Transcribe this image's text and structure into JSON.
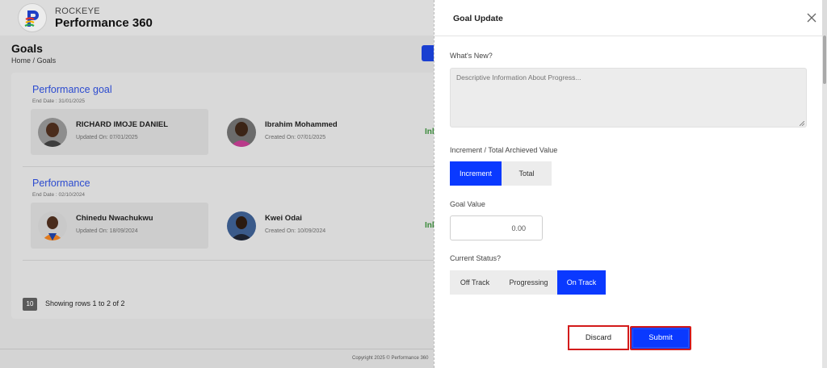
{
  "brand": {
    "small": "ROCKEYE",
    "big": "Performance 360"
  },
  "page": {
    "title": "Goals",
    "breadcrumb_home": "Home",
    "breadcrumb_sep": "/",
    "breadcrumb_current": "Goals"
  },
  "goals": [
    {
      "title": "Performance goal",
      "end_date": "End Date : 31/01/2025",
      "status_stub": "Inl",
      "people": [
        {
          "name": "RICHARD IMOJE DANIEL",
          "date": "Updated On: 07/01/2025"
        },
        {
          "name": "Ibrahim Mohammed",
          "date": "Created On: 07/01/2025"
        }
      ]
    },
    {
      "title": "Performance",
      "end_date": "End Date : 02/10/2024",
      "status_stub": "Inl",
      "people": [
        {
          "name": "Chinedu Nwachukwu",
          "date": "Updated On: 18/09/2024"
        },
        {
          "name": "Kwei Odai",
          "date": "Created On: 10/09/2024"
        }
      ]
    }
  ],
  "pagination": {
    "rows_per_page": "10",
    "summary": "Showing rows 1 to 2 of 2"
  },
  "footer": {
    "copyright": "Copyright 2025 © Performance 360"
  },
  "modal": {
    "title": "Goal Update",
    "whats_new_label": "What's New?",
    "whats_new_placeholder": "Descriptive Information About Progress...",
    "increment_label": "Increment / Total Archieved Value",
    "increment_options": {
      "increment": "Increment",
      "total": "Total"
    },
    "increment_selected": "Increment",
    "goal_value_label": "Goal Value",
    "goal_value": "0.00",
    "status_label": "Current Status?",
    "status_options": {
      "off_track": "Off Track",
      "progressing": "Progressing",
      "on_track": "On Track"
    },
    "status_selected": "On Track",
    "discard_label": "Discard",
    "submit_label": "Submit"
  },
  "colors": {
    "accent": "#0a39ff",
    "highlight_border": "#d31b1b",
    "link_blue": "#2c4bcf"
  }
}
